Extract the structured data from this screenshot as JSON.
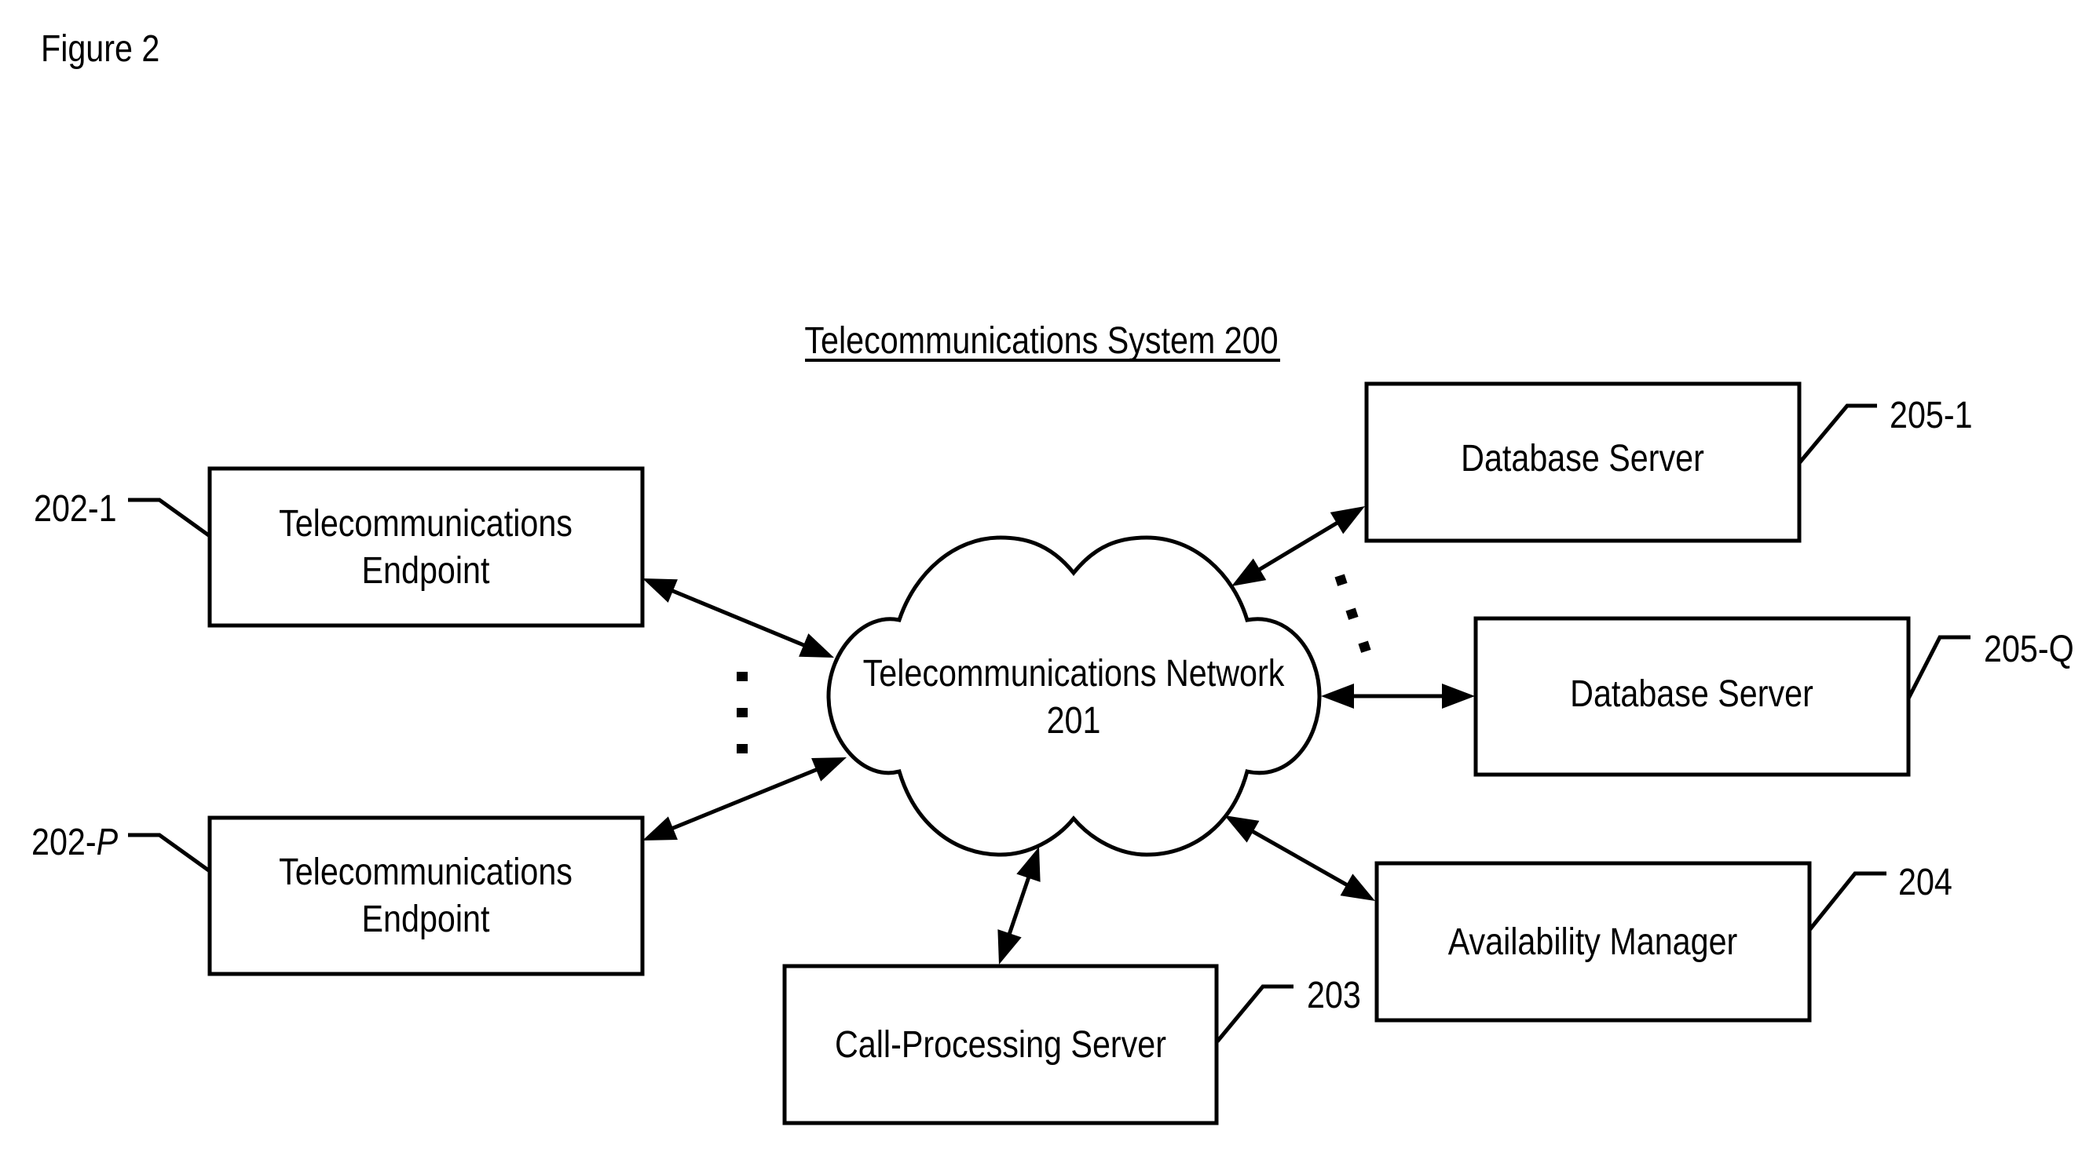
{
  "figure_label": "Figure 2",
  "system_title": "Telecommunications System 200",
  "network": {
    "name": "Telecommunications Network",
    "ref": "201"
  },
  "nodes": [
    {
      "id": "endpoint-1",
      "lines": [
        "Telecommunications",
        "Endpoint"
      ],
      "ref_prefix": "202-",
      "ref_suffix": "1",
      "ref_suffix_italic": false
    },
    {
      "id": "endpoint-p",
      "lines": [
        "Telecommunications",
        "Endpoint"
      ],
      "ref_prefix": "202-",
      "ref_suffix": "P",
      "ref_suffix_italic": true
    },
    {
      "id": "call-processing-server",
      "lines": [
        "Call-Processing Server"
      ],
      "ref_prefix": "203",
      "ref_suffix": "",
      "ref_suffix_italic": false
    },
    {
      "id": "availability-manager",
      "lines": [
        "Availability Manager"
      ],
      "ref_prefix": "204",
      "ref_suffix": "",
      "ref_suffix_italic": false
    },
    {
      "id": "database-server-1",
      "lines": [
        "Database Server"
      ],
      "ref_prefix": "205-",
      "ref_suffix": "1",
      "ref_suffix_italic": false
    },
    {
      "id": "database-server-q",
      "lines": [
        "Database Server"
      ],
      "ref_prefix": "205-",
      "ref_suffix": "Q",
      "ref_suffix_italic": false
    }
  ],
  "connections": [
    {
      "from": "endpoint-1",
      "to": "network",
      "bidirectional": true
    },
    {
      "from": "endpoint-p",
      "to": "network",
      "bidirectional": true
    },
    {
      "from": "call-processing-server",
      "to": "network",
      "bidirectional": true
    },
    {
      "from": "availability-manager",
      "to": "network",
      "bidirectional": true
    },
    {
      "from": "database-server-1",
      "to": "network",
      "bidirectional": true
    },
    {
      "from": "database-server-q",
      "to": "network",
      "bidirectional": true
    }
  ],
  "ellipses": [
    {
      "between": [
        "endpoint-1",
        "endpoint-p"
      ],
      "symbol": "vertical-dots"
    },
    {
      "between": [
        "database-server-1",
        "database-server-q"
      ],
      "symbol": "vertical-dots"
    }
  ]
}
